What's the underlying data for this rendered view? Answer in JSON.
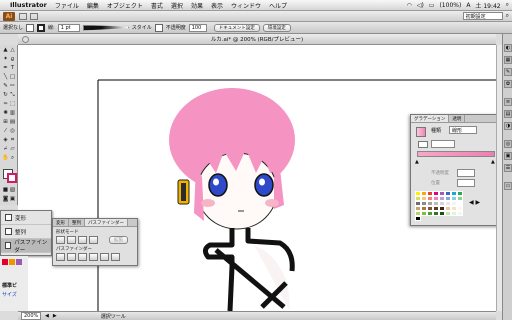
{
  "menubar": {
    "app_name": "Illustrator",
    "items": [
      "ファイル",
      "編集",
      "オブジェクト",
      "書式",
      "選択",
      "効果",
      "表示",
      "ウィンドウ",
      "ヘルプ"
    ],
    "battery": "(100%)",
    "input_mode": "A",
    "clock": "土 19:42"
  },
  "appbar": {
    "logo": "Ai",
    "workspace": "初期設定"
  },
  "controlbar": {
    "label": "選択なし",
    "stroke_weight": "1 pt",
    "style_label": "スタイル",
    "opacity_label": "不透明度",
    "opacity_value": "100",
    "doc_setup": "ドキュメント設定",
    "prefs": "環境設定"
  },
  "document": {
    "title": "ルカ.ai* @ 200% (RGB/プレビュー)"
  },
  "statusbar": {
    "zoom": "200%",
    "info": "選択ツール"
  },
  "leftpanel": {
    "items": [
      "変形",
      "整列",
      "パスファインダー"
    ]
  },
  "leftbelow": {
    "label1": "標準ビ",
    "label2": "サイズ"
  },
  "pathfinder_panel": {
    "tabs": [
      "変形",
      "整列",
      "パスファインダー"
    ],
    "shape_mode": "形状モード",
    "pathfinder": "パスファインダー",
    "expand": "拡張"
  },
  "gradient_panel": {
    "tabs": [
      "グラデーション",
      "透明"
    ],
    "type_label": "種類",
    "type_value": "線形",
    "opacity_label": "不透明度",
    "position_label": "位置"
  },
  "colors": {
    "hair": "#f593c3",
    "hair_shadow": "#e46fa8",
    "eyes": "#2e49c9",
    "skin": "#fffaf8",
    "blush": "#f6b4c6",
    "headphone": "#f0b400"
  }
}
